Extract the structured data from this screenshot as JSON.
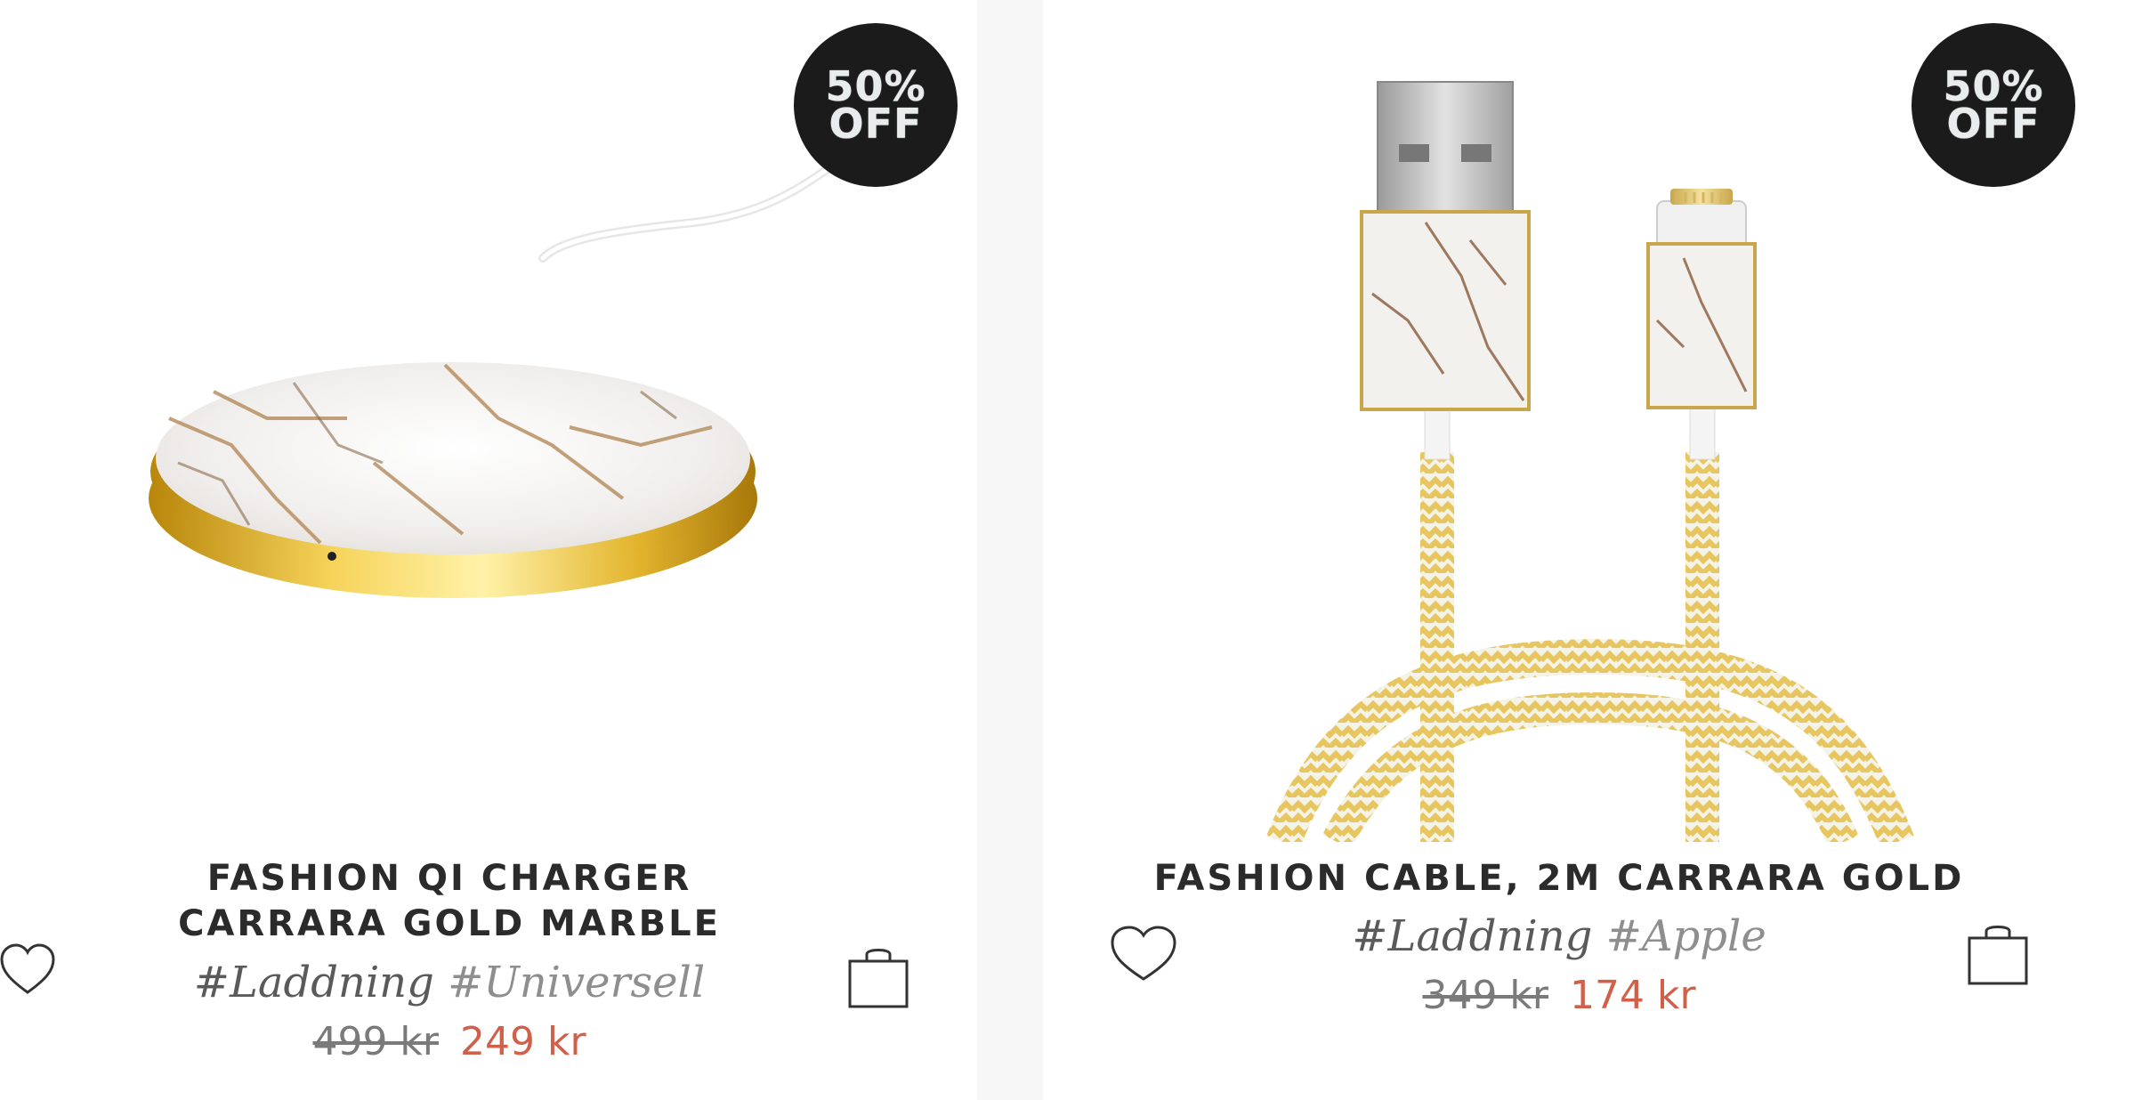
{
  "products": [
    {
      "badge": {
        "line1": "50%",
        "line2": "OFF"
      },
      "title": "FASHION QI CHARGER CARRARA GOLD MARBLE",
      "tags": [
        "#Laddning",
        "#Universell"
      ],
      "old_price": "499 kr",
      "new_price": "249 kr"
    },
    {
      "badge": {
        "line1": "50%",
        "line2": "OFF"
      },
      "title": "FASHION CABLE, 2M CARRARA GOLD",
      "tags": [
        "#Laddning",
        "#Apple"
      ],
      "old_price": "349 kr",
      "new_price": "174 kr"
    }
  ],
  "icons": {
    "wishlist": "heart-icon",
    "cart": "shopping-bag-icon"
  },
  "colors": {
    "sale_price": "#d0604a",
    "badge_bg": "#1b1b1b",
    "text": "#2b2b2b"
  }
}
